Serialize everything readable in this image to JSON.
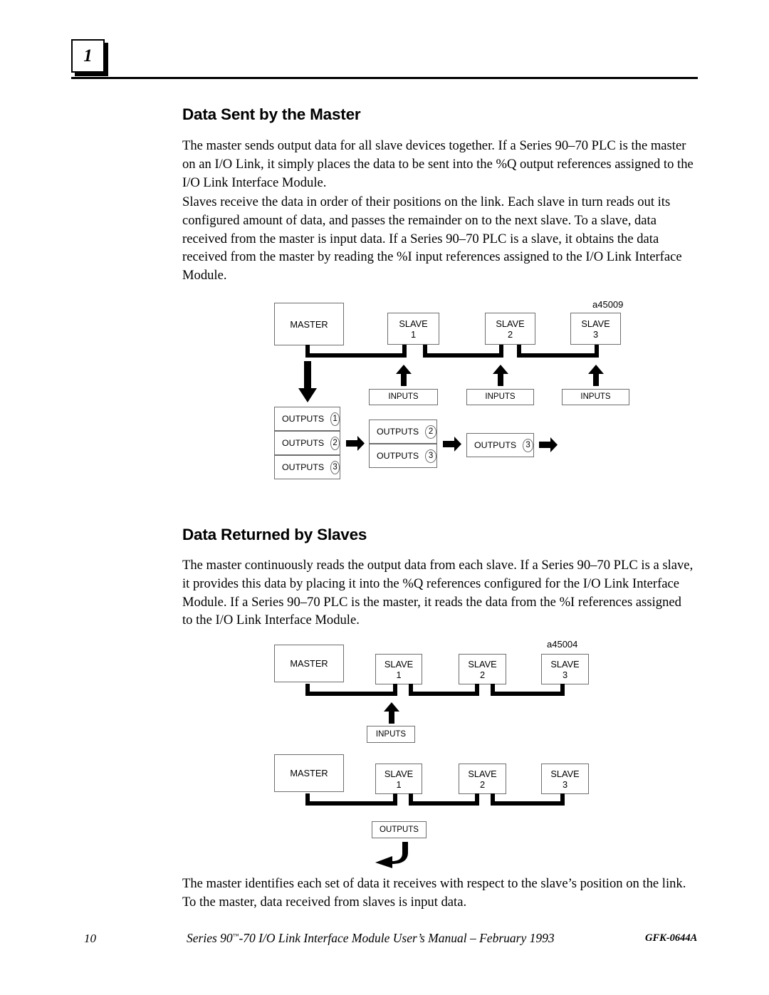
{
  "chapter_badge": "1",
  "sections": [
    {
      "heading": "Data Sent by the Master",
      "paragraphs": [
        "The master sends output data for all slave devices together.  If a Series 90–70 PLC is the master on an I/O Link, it simply places the data to be sent into the %Q output references assigned to the I/O Link Interface Module.",
        "Slaves receive the data in order of their positions on the link.  Each slave in turn reads out its configured amount of data, and passes the remainder on to the next slave.  To a slave, data received from the master is input data.  If a Series 90–70 PLC is a slave, it obtains the data received from the master by reading the %I input references assigned to the I/O Link Interface Module."
      ]
    },
    {
      "heading": "Data Returned by Slaves",
      "paragraphs": [
        "The master continuously reads the output data from each slave.  If a Series 90–70 PLC is a slave, it provides this data by placing it into the %Q references configured for the I/O Link Interface Module.  If a Series 90–70 PLC is the master, it reads the data from the %I references assigned to the I/O Link Interface Module.",
        "The master identifies each set of data it receives with respect to the slave’s position on the link.  To the master, data received from slaves is input data."
      ]
    }
  ],
  "figure1": {
    "id_label": "a45009",
    "master": "MASTER",
    "slaves": [
      {
        "name": "SLAVE",
        "num": "1"
      },
      {
        "name": "SLAVE",
        "num": "2"
      },
      {
        "name": "SLAVE",
        "num": "3"
      }
    ],
    "inputs": [
      "INPUTS",
      "INPUTS",
      "INPUTS"
    ],
    "output_stacks": [
      {
        "rows": [
          {
            "label": "OUTPUTS",
            "num": "1"
          },
          {
            "label": "OUTPUTS",
            "num": "2"
          },
          {
            "label": "OUTPUTS",
            "num": "3"
          }
        ]
      },
      {
        "rows": [
          {
            "label": "OUTPUTS",
            "num": "2"
          },
          {
            "label": "OUTPUTS",
            "num": "3"
          }
        ]
      },
      {
        "rows": [
          {
            "label": "OUTPUTS",
            "num": "3"
          }
        ]
      }
    ]
  },
  "figure2": {
    "id_label": "a45004",
    "row_a": {
      "master": "MASTER",
      "slaves": [
        {
          "name": "SLAVE",
          "num": "1"
        },
        {
          "name": "SLAVE",
          "num": "2"
        },
        {
          "name": "SLAVE",
          "num": "3"
        }
      ],
      "inputs": "INPUTS"
    },
    "row_b": {
      "master": "MASTER",
      "slaves": [
        {
          "name": "SLAVE",
          "num": "1"
        },
        {
          "name": "SLAVE",
          "num": "2"
        },
        {
          "name": "SLAVE",
          "num": "3"
        }
      ],
      "outputs": "OUTPUTS"
    }
  },
  "footer": {
    "page_number": "10",
    "title_pre": "Series 90",
    "title_tm": "™",
    "title_post": "-70 I/O Link Interface Module User’s Manual – February 1993",
    "doc_number": "GFK-0644A"
  }
}
